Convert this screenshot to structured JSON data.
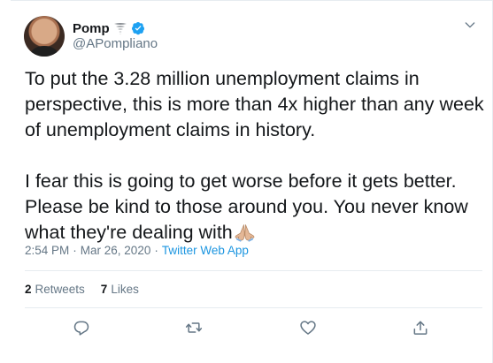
{
  "author": {
    "display_name": "Pomp",
    "handle": "@APompliano",
    "badges": [
      "tornado-icon",
      "verified-icon"
    ]
  },
  "tweet": {
    "paragraphs": [
      "To put the 3.28 million unemployment claims in perspective, this is more than 4x higher than any week of unemployment claims in history.",
      "I fear this is going to get worse before it gets better. Please be kind to those around you. You never know what they're dealing with"
    ],
    "emoji": "pray-emoji"
  },
  "meta": {
    "time": "2:54 PM",
    "separator_1": "·",
    "date": "Mar 26, 2020",
    "separator_2": "·",
    "source": "Twitter Web App"
  },
  "stats": {
    "retweets_count": "2",
    "retweets_label": "Retweets",
    "likes_count": "7",
    "likes_label": "Likes"
  },
  "actions": [
    "reply-icon",
    "retweet-icon",
    "like-icon",
    "share-icon"
  ],
  "colors": {
    "text": "#14171a",
    "secondary": "#657786",
    "link": "#1b95e0",
    "verified": "#1da1f2",
    "divider": "#e6ecf0"
  }
}
